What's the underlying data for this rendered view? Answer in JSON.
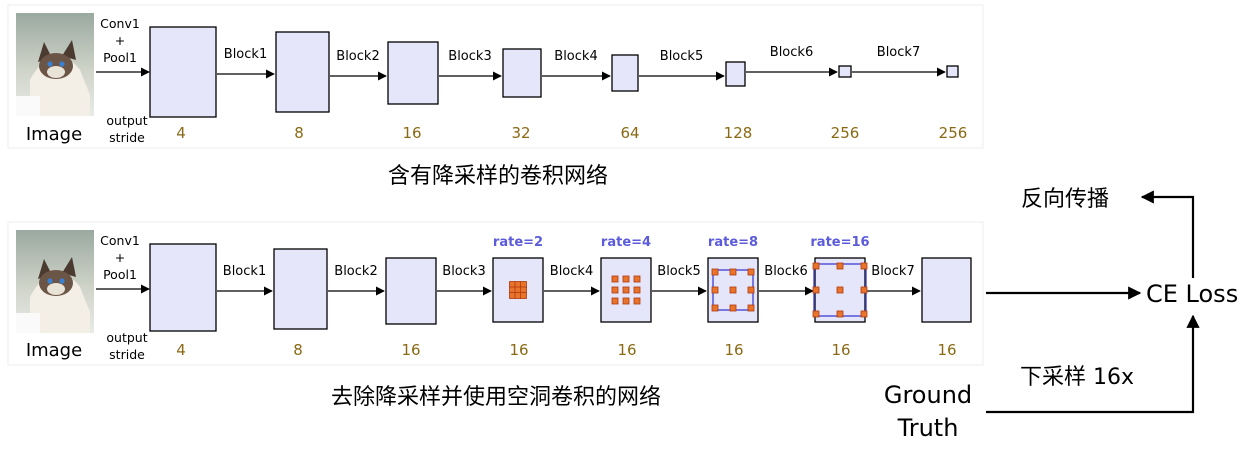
{
  "colors": {
    "block_fill": "#e6e6fa",
    "block_stroke": "#000000",
    "stride_text": "#8b6914",
    "rate_text": "#5b5bdb",
    "dot_fill": "#e8742c",
    "dot_stroke": "#b03a10",
    "dilation_line": "#4a4ad6"
  },
  "top_row": {
    "image_label": "Image",
    "first_op": [
      "Conv1",
      "+",
      "Pool1"
    ],
    "output_stride_label": [
      "output",
      "stride"
    ],
    "block_labels": [
      "Block1",
      "Block2",
      "Block3",
      "Block4",
      "Block5",
      "Block6",
      "Block7"
    ],
    "strides": [
      "4",
      "8",
      "16",
      "32",
      "64",
      "128",
      "256",
      "256"
    ],
    "caption": "含有降采样的卷积网络"
  },
  "bottom_row": {
    "image_label": "Image",
    "first_op": [
      "Conv1",
      "+",
      "Pool1"
    ],
    "output_stride_label": [
      "output",
      "stride"
    ],
    "block_labels": [
      "Block1",
      "Block2",
      "Block3",
      "Block4",
      "Block5",
      "Block6",
      "Block7"
    ],
    "strides": [
      "4",
      "8",
      "16",
      "16",
      "16",
      "16",
      "16",
      "16"
    ],
    "rates": [
      "rate=2",
      "rate=4",
      "rate=8",
      "rate=16"
    ],
    "caption": "去除降采样并使用空洞卷积的网络"
  },
  "right_side": {
    "ce_loss": "CE Loss",
    "backprop": "反向传播",
    "downsample": "下采样 16x",
    "ground_truth": [
      "Ground",
      "Truth"
    ]
  }
}
